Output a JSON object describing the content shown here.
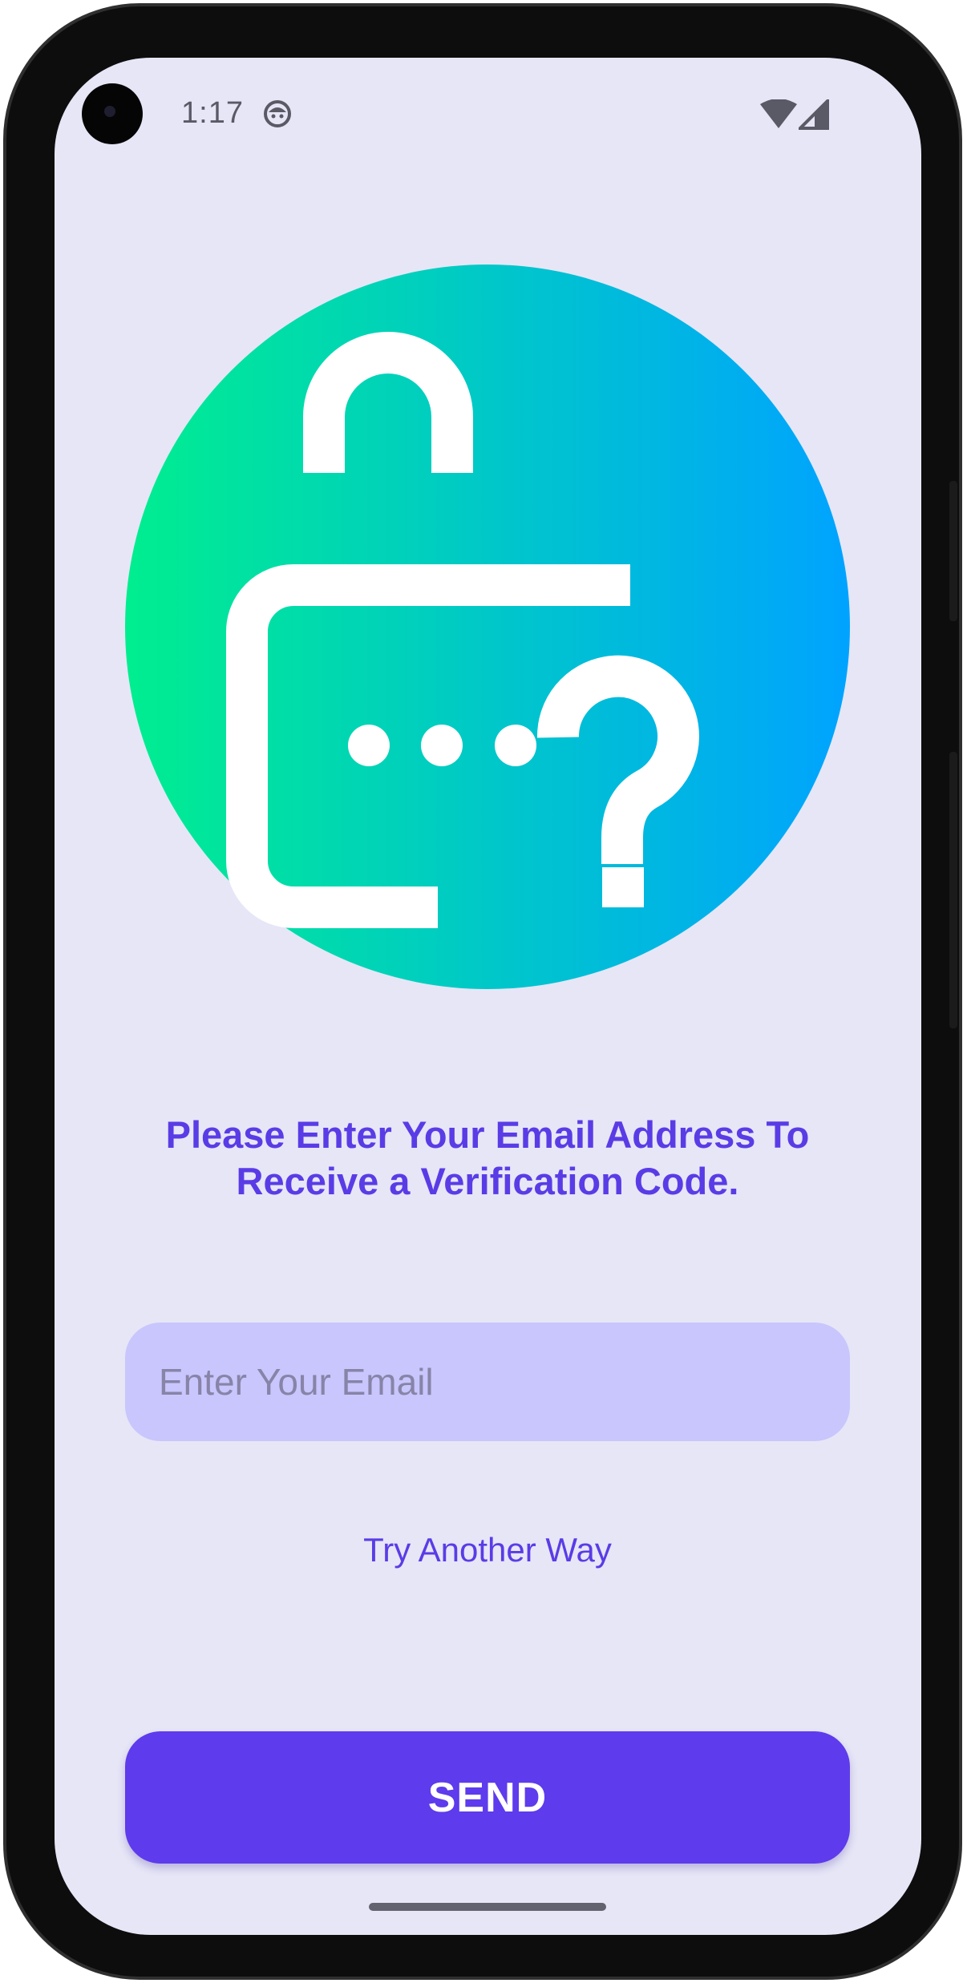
{
  "status_bar": {
    "time": "1:17",
    "notification_icon": "android-face-icon",
    "wifi_icon": "wifi-icon",
    "signal_icon": "cellular-signal-icon"
  },
  "hero": {
    "icon": "lock-question-icon",
    "gradient_colors": [
      "#00ee8f",
      "#00c8c8",
      "#00a3ff"
    ]
  },
  "prompt": {
    "line1": "Please Enter Your Email Address To",
    "line2": "Receive a Verification Code."
  },
  "email_input": {
    "placeholder": "Enter Your Email",
    "value": ""
  },
  "try_another_way": "Try Another Way",
  "send_button": "SEND",
  "colors": {
    "accent": "#5e3bec",
    "background": "#e6e6f7",
    "input_background": "#c8c6fc"
  }
}
